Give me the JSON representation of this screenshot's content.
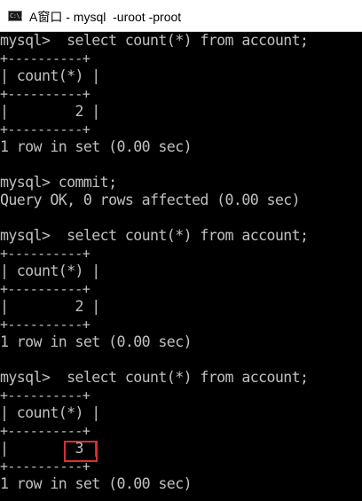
{
  "window": {
    "title": "A窗口 - mysql  -uroot -proot",
    "icon": "cmd-console-icon",
    "icon_text": "C:\\."
  },
  "console": {
    "lines": [
      "mysql>  select count(*) from account;",
      "+----------+",
      "| count(*) |",
      "+----------+",
      "|        2 |",
      "+----------+",
      "1 row in set (0.00 sec)",
      "",
      "mysql> commit;",
      "Query OK, 0 rows affected (0.00 sec)",
      "",
      "mysql>  select count(*) from account;",
      "+----------+",
      "| count(*) |",
      "+----------+",
      "|        2 |",
      "+----------+",
      "1 row in set (0.00 sec)",
      "",
      "mysql>  select count(*) from account;",
      "+----------+",
      "| count(*) |",
      "+----------+",
      "|        3 |",
      "+----------+",
      "1 row in set (0.00 sec)"
    ]
  },
  "colors": {
    "background": "#000000",
    "text": "#c0c0c0",
    "highlight": "#d9302f"
  }
}
